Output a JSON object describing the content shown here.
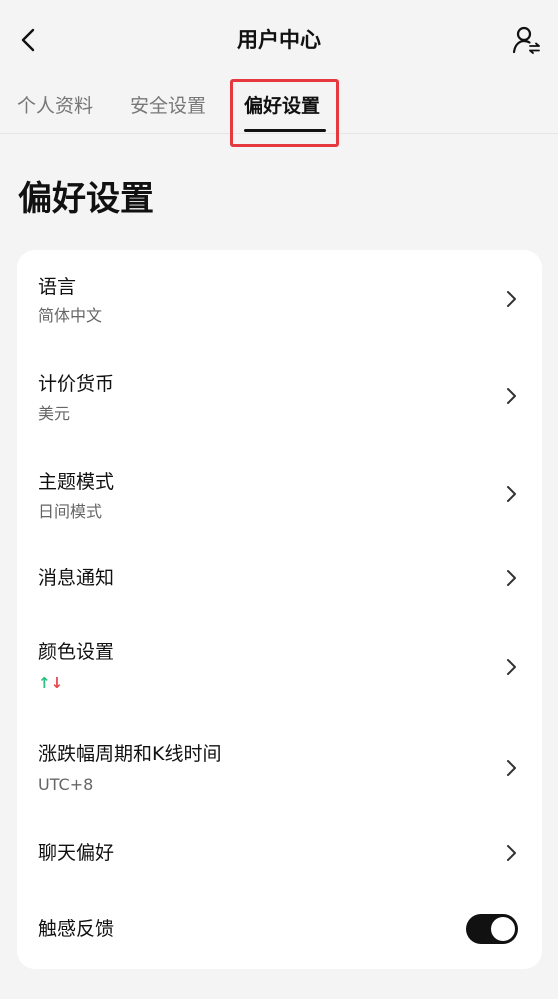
{
  "header": {
    "title": "用户中心",
    "back_icon": "chevron-left-icon",
    "right_icon": "user-switch-icon"
  },
  "tabs": [
    {
      "label": "个人资料",
      "active": false
    },
    {
      "label": "安全设置",
      "active": false
    },
    {
      "label": "偏好设置",
      "active": true
    }
  ],
  "section": {
    "title": "偏好设置"
  },
  "settings": [
    {
      "label": "语言",
      "value": "简体中文"
    },
    {
      "label": "计价货币",
      "value": "美元"
    },
    {
      "label": "主题模式",
      "value": "日间模式"
    },
    {
      "label": "消息通知"
    },
    {
      "label": "颜色设置",
      "arrow_up": "↑",
      "arrow_down": "↓"
    },
    {
      "label": "涨跌幅周期和K线时间",
      "value": "UTC+8"
    },
    {
      "label": "聊天偏好"
    },
    {
      "label": "触感反馈",
      "toggle_on": true
    }
  ],
  "colors": {
    "accent": "#111111",
    "up": "#2ebd85",
    "down": "#e5484d",
    "highlight": "#e5393f",
    "background": "#f4f4f4"
  }
}
